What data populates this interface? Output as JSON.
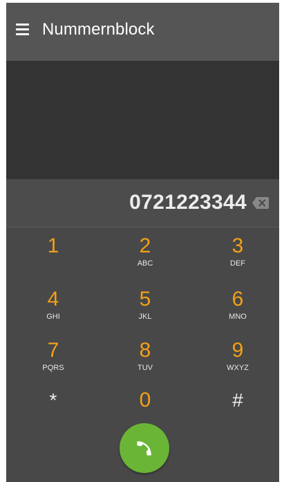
{
  "appbar": {
    "menu_icon": "hamburger-menu-icon",
    "title": "Nummernblock"
  },
  "dialer": {
    "number": "0721223344",
    "backspace_icon": "backspace-icon"
  },
  "keypad": {
    "keys": [
      {
        "digit": "1",
        "letters": ""
      },
      {
        "digit": "2",
        "letters": "ABC"
      },
      {
        "digit": "3",
        "letters": "DEF"
      },
      {
        "digit": "4",
        "letters": "GHI"
      },
      {
        "digit": "5",
        "letters": "JKL"
      },
      {
        "digit": "6",
        "letters": "MNO"
      },
      {
        "digit": "7",
        "letters": "PQRS"
      },
      {
        "digit": "8",
        "letters": "TUV"
      },
      {
        "digit": "9",
        "letters": "WXYZ"
      },
      {
        "digit": "*",
        "letters": ""
      },
      {
        "digit": "0",
        "letters": ""
      },
      {
        "digit": "#",
        "letters": ""
      }
    ]
  },
  "call_button": {
    "icon": "phone-hangup-icon",
    "color": "#6ab536"
  },
  "colors": {
    "digit": "#f3a017",
    "appbar": "#555555",
    "display": "#333333",
    "keypad_bg": "#484848"
  }
}
